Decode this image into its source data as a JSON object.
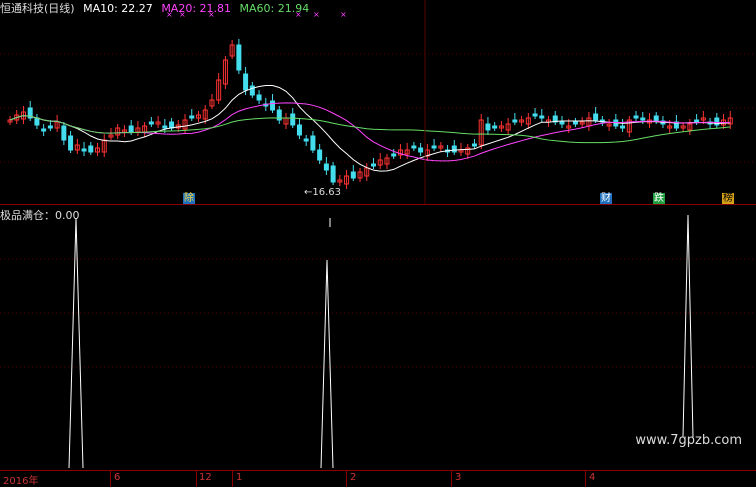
{
  "header": {
    "title": "恒通科技(日线)",
    "ma10": "MA10: 22.27",
    "ma20": "MA20: 21.81",
    "ma60": "MA60: 21.94",
    "colors": {
      "title": "#dddddd",
      "ma10": "#ffffff",
      "ma20": "#ff44ff",
      "ma60": "#66dd66"
    }
  },
  "main_chart": {
    "low_label": "←16.63",
    "marker_glyph": "×",
    "event_tags": [
      {
        "text": "除",
        "bg": "#1f6fbf",
        "fg": "#ffdd33"
      },
      {
        "text": "财",
        "bg": "#1f6fbf",
        "fg": "#ffffff"
      },
      {
        "text": "跌",
        "bg": "#1f9f3f",
        "fg": "#ffffff"
      },
      {
        "text": "榜",
        "bg": "#d4a017",
        "fg": "#000000"
      }
    ]
  },
  "indicator": {
    "title": "极品满仓：0.00"
  },
  "time_axis": {
    "labels": [
      "2016年",
      "6",
      "12",
      "1",
      "2",
      "3",
      "4"
    ]
  },
  "watermark": "www.7gpzb.com",
  "colors": {
    "up": "#ff3333",
    "down": "#44ddee",
    "grid": "#8b0000",
    "bg": "#000000"
  }
}
